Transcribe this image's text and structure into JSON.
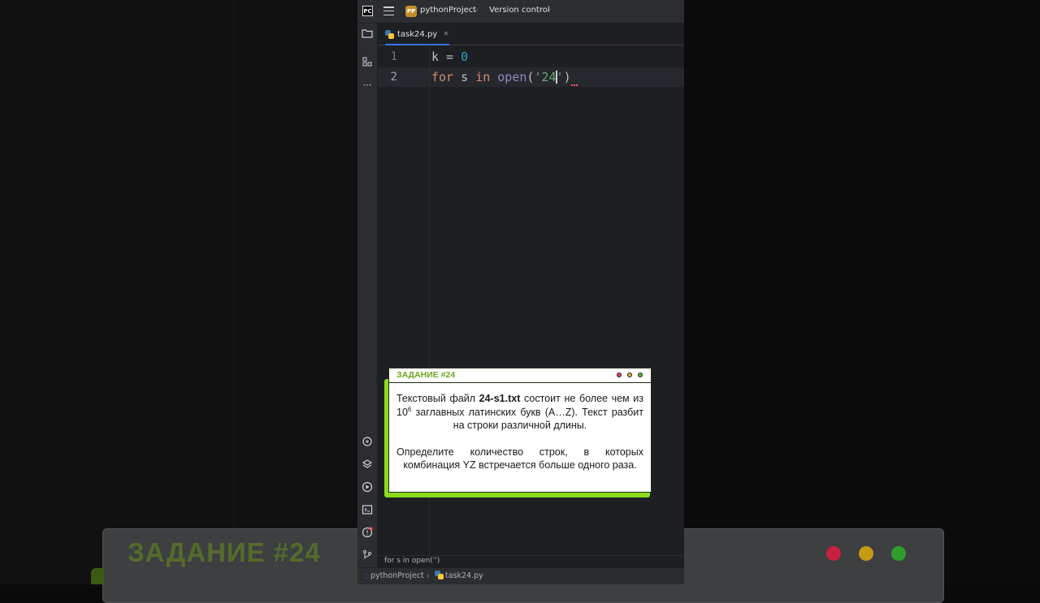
{
  "ide": {
    "project_badge": "PP",
    "project_name": "pythonProject",
    "version_control": "Version control",
    "tab": {
      "filename": "task24.py",
      "close": "×"
    },
    "code": {
      "line_numbers": [
        "1",
        "2"
      ],
      "line1": {
        "var": "k",
        "op": " = ",
        "num": "0"
      },
      "line2": {
        "kw_for": "for",
        "var": " s ",
        "kw_in": "in",
        "fn": " open",
        "open_paren": "(",
        "str_open": "'24",
        "str_close": "'",
        "close_paren": ")"
      }
    },
    "breadcrumb_code": "for s in open('')",
    "status": {
      "project": "pythonProject",
      "file": "task24.py"
    },
    "colors": {
      "keyword": "#cf8e6d",
      "number": "#2aacb8",
      "builtin": "#8888c6",
      "string": "#6aab73",
      "accent": "#3574f0"
    }
  },
  "task_card": {
    "title": "ЗАДАНИЕ #24",
    "p1_before": "Текстовый файл ",
    "p1_file": "24-s1.txt",
    "p1_mid": " состоит не более чем из 10",
    "p1_sup": "6",
    "p1_after": " заглавных латинских букв (A…Z). Текст разбит на строки различной длины.",
    "p2": "Определите количество строк, в которых комбинация YZ встречается больше одного раза.",
    "dot_colors": [
      "#e2425a",
      "#f2a53a",
      "#5fbf3b"
    ]
  },
  "background": {
    "title": "ЗАДАНИЕ #24",
    "dot_colors": [
      "#c8203f",
      "#c79a14",
      "#2e9d2e"
    ]
  }
}
